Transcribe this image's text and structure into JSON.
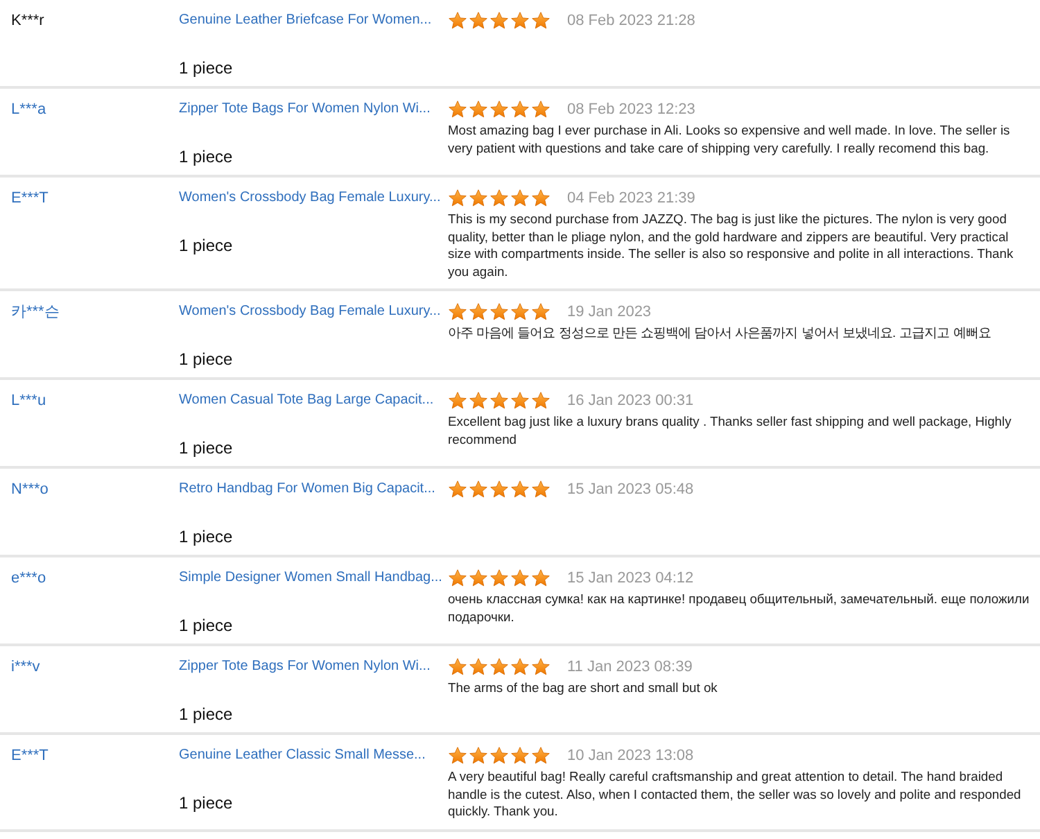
{
  "reviews": [
    {
      "buyer": "K***r",
      "buyer_link": false,
      "product": "Genuine Leather Briefcase For Women...",
      "quantity": "1 piece",
      "stars": 5,
      "date": "08 Feb 2023 21:28"
    },
    {
      "buyer": "L***a",
      "buyer_link": true,
      "product": "Zipper Tote Bags For Women Nylon Wi...",
      "quantity": "1 piece",
      "stars": 5,
      "date": "08 Feb 2023 12:23",
      "comment": "Most amazing bag I ever purchase in Ali. Looks so expensive and well made. In love. The seller is very patient with questions and take care of shipping very carefully. I really recomend this bag."
    },
    {
      "buyer": "E***T",
      "buyer_link": true,
      "product": "Women's Crossbody Bag Female Luxury...",
      "quantity": "1 piece",
      "stars": 5,
      "date": "04 Feb 2023 21:39",
      "comment": "This is my second purchase from JAZZQ. The bag is just like the pictures. The nylon is very good quality, better than le pliage nylon, and the gold hardware and zippers are beautiful. Very practical size with compartments inside. The seller is also so responsive and polite in all interactions. Thank you again."
    },
    {
      "buyer": "카***슨",
      "buyer_link": true,
      "product": "Women's Crossbody Bag Female Luxury...",
      "quantity": "1 piece",
      "stars": 5,
      "date": "19 Jan 2023",
      "comment": "아주 마음에 들어요 정성으로 만든 쇼핑백에 담아서 사은품까지 넣어서 보냈네요. 고급지고 예뻐요"
    },
    {
      "buyer": "L***u",
      "buyer_link": true,
      "product": "Women Casual Tote Bag Large Capacit...",
      "quantity": "1 piece",
      "stars": 5,
      "date": "16 Jan 2023 00:31",
      "comment": "Excellent bag just like a luxury brans quality . Thanks seller fast shipping and well package, Highly recommend"
    },
    {
      "buyer": "N***o",
      "buyer_link": true,
      "product": "Retro Handbag For Women Big Capacit...",
      "quantity": "1 piece",
      "stars": 5,
      "date": "15 Jan 2023 05:48"
    },
    {
      "buyer": "e***o",
      "buyer_link": true,
      "product": "Simple Designer Women Small Handbag...",
      "quantity": "1 piece",
      "stars": 5,
      "date": "15 Jan 2023 04:12",
      "comment": "очень классная сумка! как на картинке! продавец общительный, замечательный. еще положили подарочки."
    },
    {
      "buyer": "i***v",
      "buyer_link": true,
      "product": "Zipper Tote Bags For Women Nylon Wi...",
      "quantity": "1 piece",
      "stars": 5,
      "date": "11 Jan 2023 08:39",
      "comment": "The arms of the bag are short and small but ok"
    },
    {
      "buyer": "E***T",
      "buyer_link": true,
      "product": "Genuine Leather Classic Small Messe...",
      "quantity": "1 piece",
      "stars": 5,
      "date": "10 Jan 2023 13:08",
      "comment": "A very beautiful bag! Really careful craftsmanship and great attention to detail. The hand braided handle is the cutest. Also, when I contacted them, the seller was so lovely and polite and responded quickly. Thank you."
    }
  ]
}
